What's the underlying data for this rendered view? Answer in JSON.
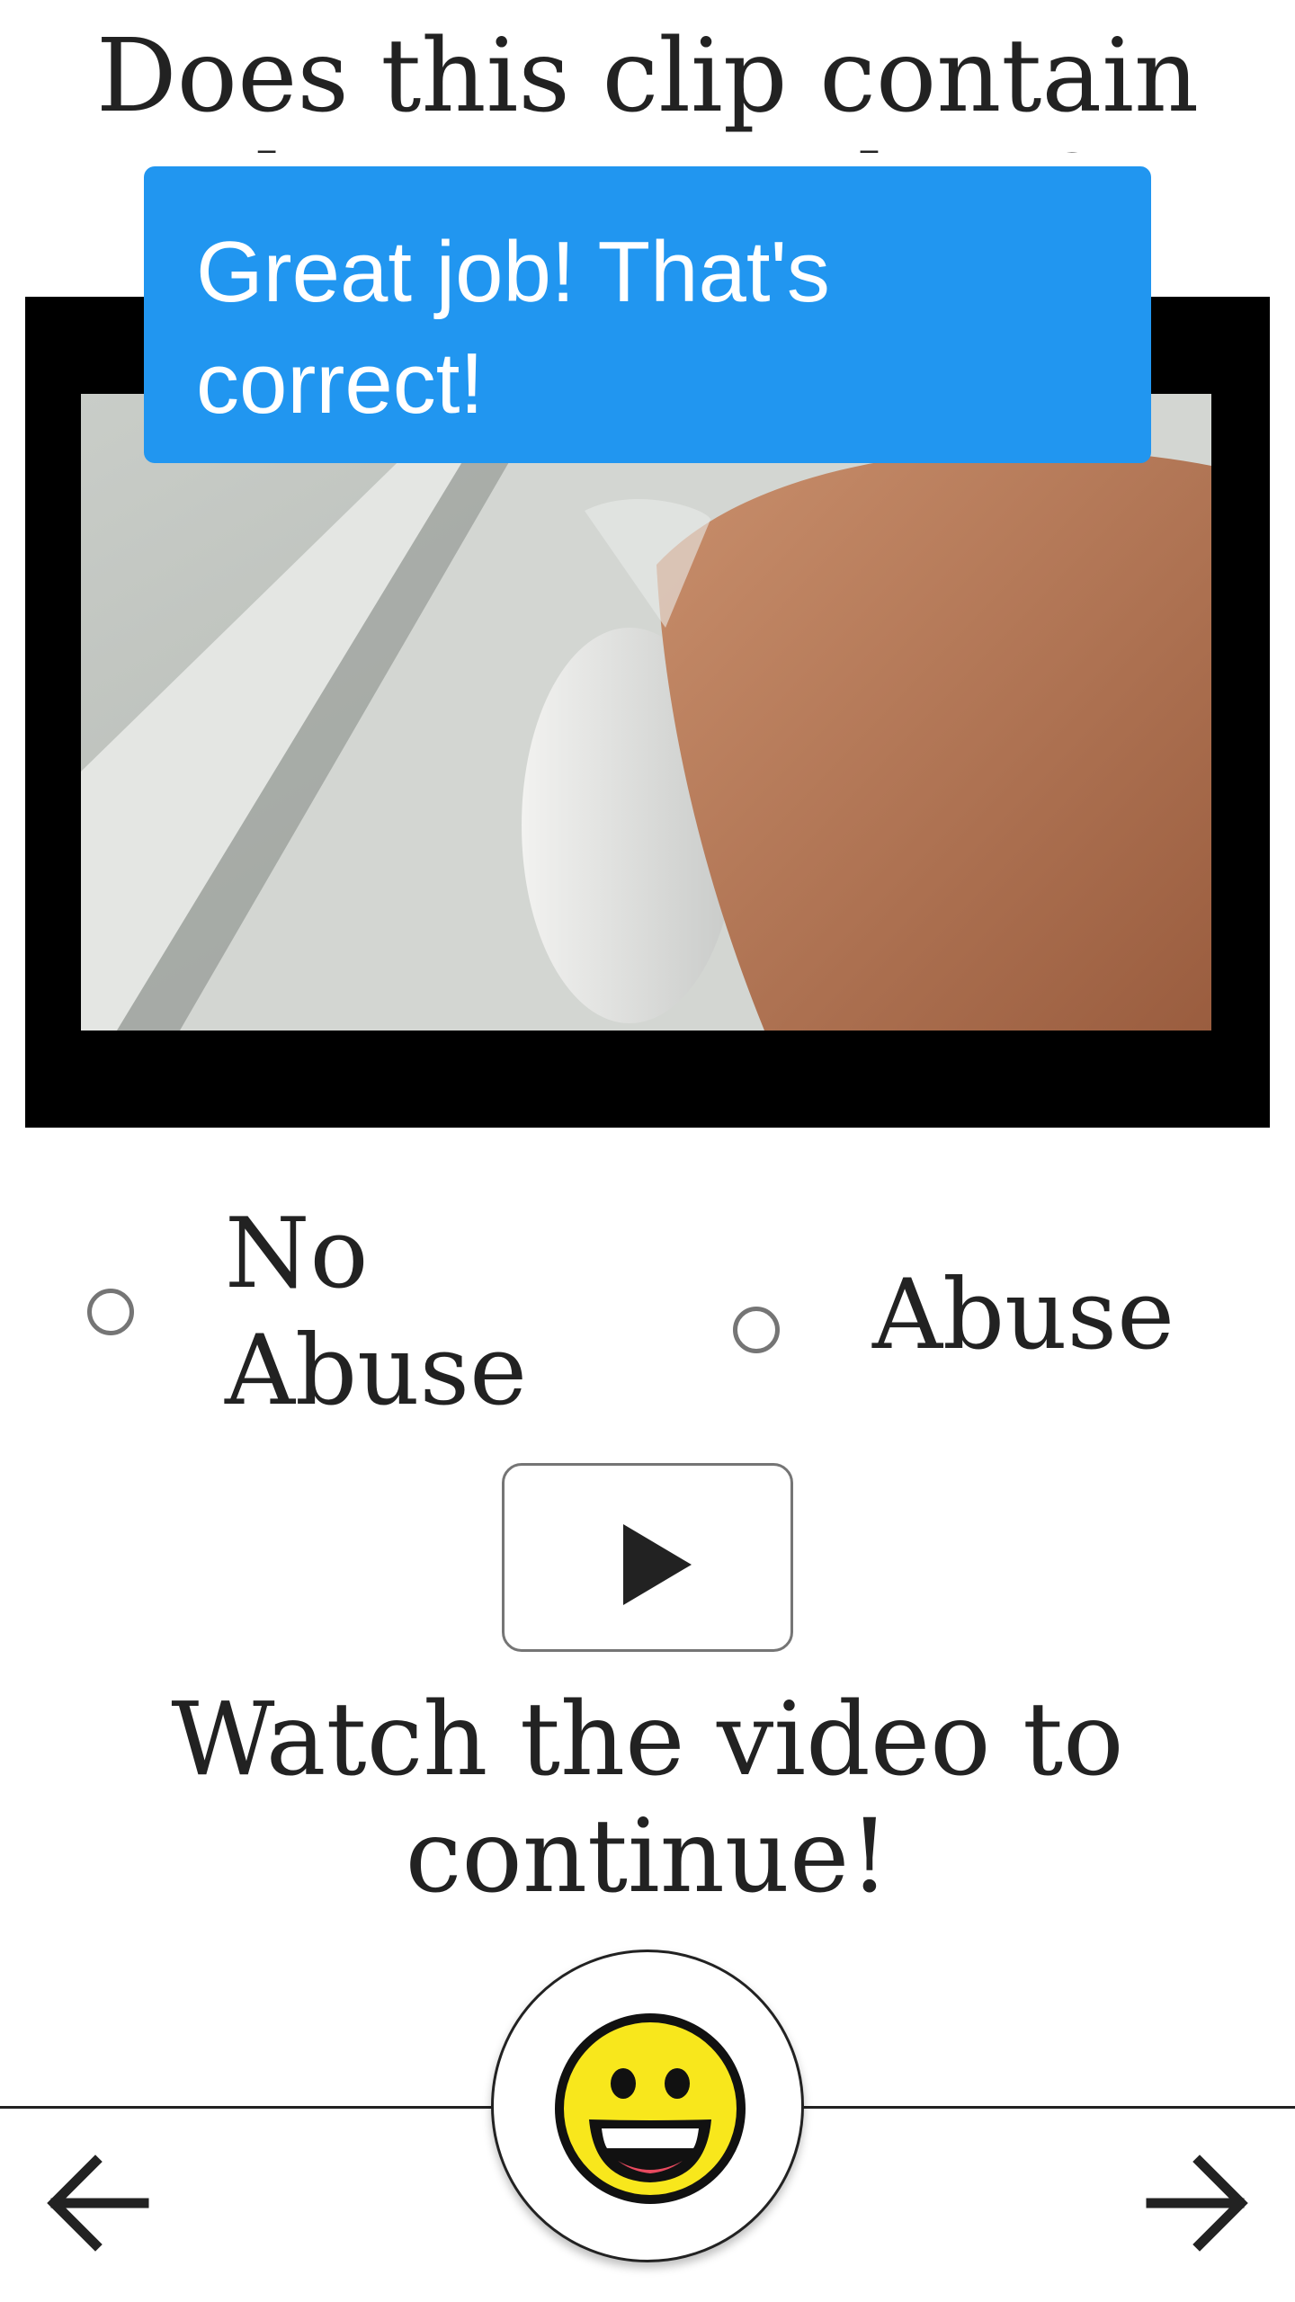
{
  "question": {
    "text": "Does this clip contain abuse or neglect?"
  },
  "toast": {
    "message": "Great job! That's correct!",
    "color": "#2196f0"
  },
  "video": {
    "thumbnail_icon": "video-frame"
  },
  "choices": [
    {
      "label": "No Abuse",
      "selected": false
    },
    {
      "label": "Abuse",
      "selected": false
    }
  ],
  "play_button": {
    "icon": "play-icon"
  },
  "status": {
    "message": "Watch the video to continue!"
  },
  "footer": {
    "emoji_icon": "grinning-face-icon",
    "back_icon": "arrow-left-icon",
    "next_icon": "arrow-right-icon"
  }
}
